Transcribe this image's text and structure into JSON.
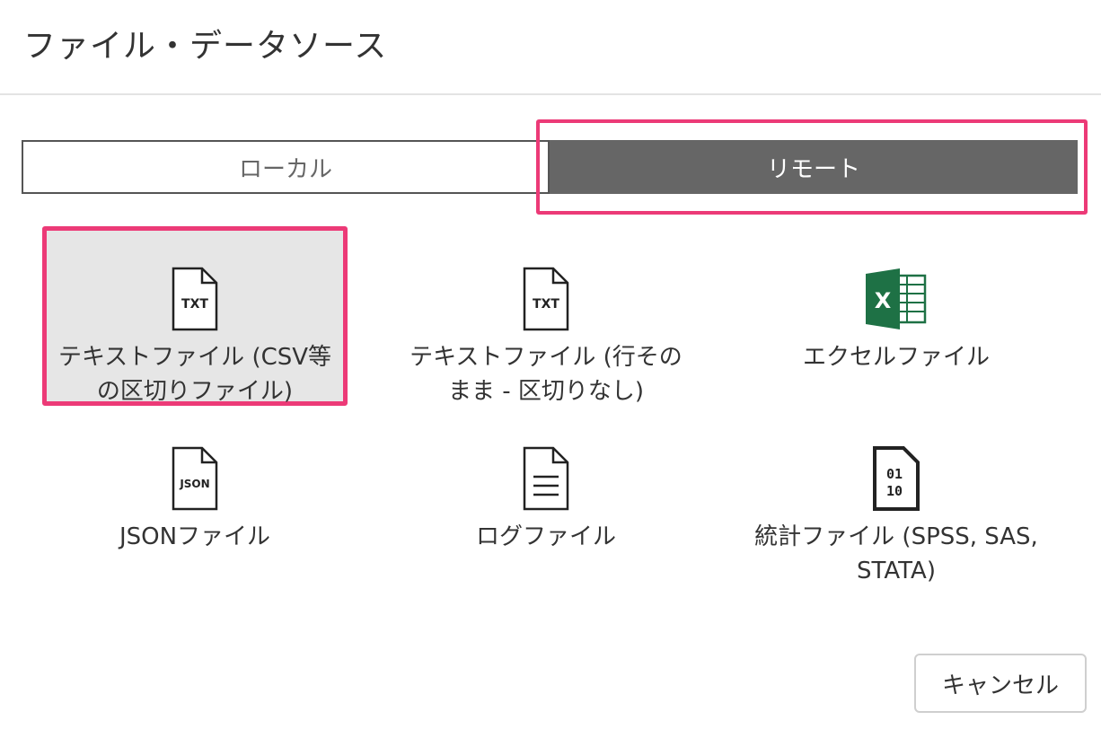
{
  "dialog": {
    "title": "ファイル・データソース"
  },
  "source_toggle": {
    "local_label": "ローカル",
    "remote_label": "リモート",
    "selected": "remote"
  },
  "file_types": [
    {
      "label": "テキストファイル (CSV等の区切りファイル)",
      "icon": "txt-file-icon",
      "selected": true
    },
    {
      "label": "テキストファイル (行そのまま - 区切りなし)",
      "icon": "txt-file-icon",
      "selected": false
    },
    {
      "label": "エクセルファイル",
      "icon": "excel-icon",
      "selected": false
    },
    {
      "label": "JSONファイル",
      "icon": "json-file-icon",
      "selected": false
    },
    {
      "label": "ログファイル",
      "icon": "log-file-icon",
      "selected": false
    },
    {
      "label": "統計ファイル (SPSS, SAS, STATA)",
      "icon": "binary-file-icon",
      "selected": false
    }
  ],
  "icon_text": {
    "txt": "TXT",
    "json": "JSON",
    "excel": "X",
    "binary_row1": "01",
    "binary_row2": "10"
  },
  "footer": {
    "cancel_label": "キャンセル"
  },
  "colors": {
    "highlight": "#ec3a77",
    "toggle_active": "#666666",
    "excel_green": "#1e7145"
  }
}
